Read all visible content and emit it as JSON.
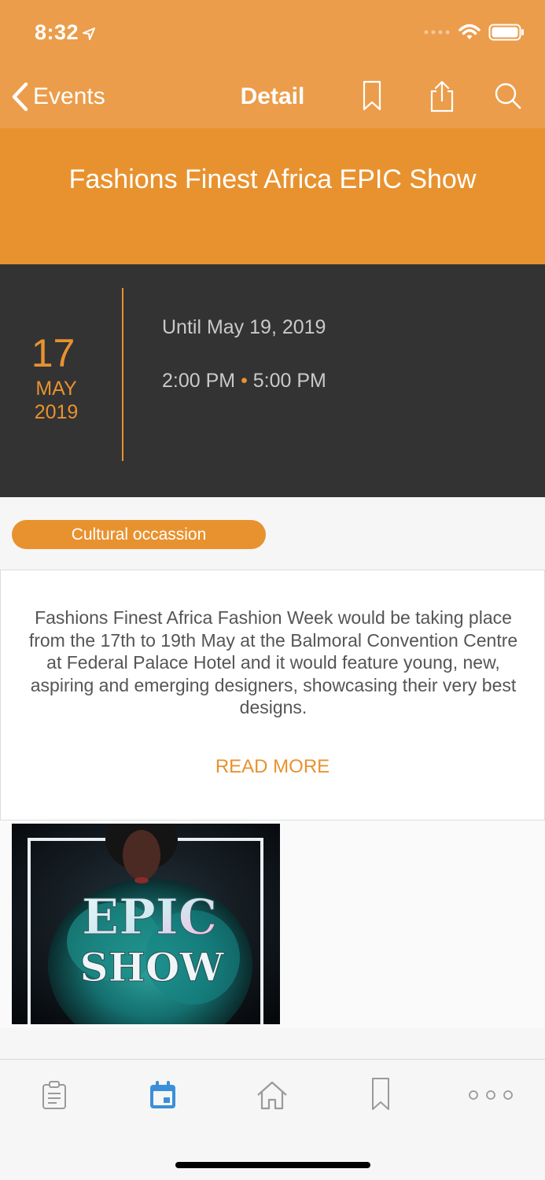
{
  "status": {
    "time": "8:32"
  },
  "nav": {
    "back_label": "Events",
    "title": "Detail"
  },
  "event": {
    "title": "Fashions Finest Africa EPIC Show",
    "day": "17",
    "month": "MAY",
    "year": "2019",
    "until": "Until May 19, 2019",
    "start_time": "2:00 PM",
    "separator": "•",
    "end_time": "5:00 PM",
    "category": "Cultural occassion",
    "description": "Fashions Finest Africa Fashion Week would be taking place from the 17th to 19th May at the Balmoral Convention Centre at Federal Palace Hotel and it would feature young, new, aspiring and emerging designers, showcasing their very best designs.",
    "read_more": "READ MORE",
    "poster_line1": "EPIC",
    "poster_line2": "SHOW"
  },
  "tabs": [
    {
      "icon": "clipboard-icon",
      "active": false
    },
    {
      "icon": "calendar-icon",
      "active": true
    },
    {
      "icon": "home-icon",
      "active": false
    },
    {
      "icon": "bookmark-icon",
      "active": false
    },
    {
      "icon": "more-icon",
      "active": false
    }
  ],
  "colors": {
    "accent": "#e8922f",
    "nav": "#eb9d4b",
    "dark": "#333333",
    "tab_active": "#3b8fd9",
    "tab_inactive": "#9a9a9a"
  }
}
